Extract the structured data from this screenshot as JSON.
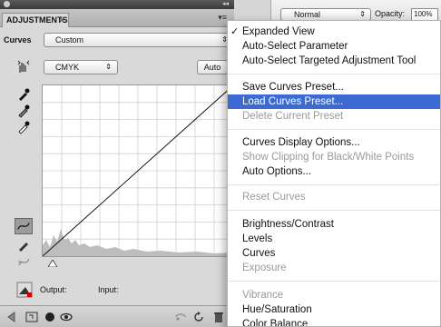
{
  "layers_bar": {
    "blend_mode": "Normal",
    "opacity_label": "Opacity:",
    "opacity_value": "100%"
  },
  "panel": {
    "tab_label": "ADJUSTMENTS",
    "tab_close": "×",
    "collapse_glyph": "◂◂",
    "menu_glyph": "▾≡",
    "adjustment_label": "Curves",
    "preset_value": "Custom",
    "channel_value": "CMYK",
    "auto_label": "Auto",
    "output_label": "Output:",
    "input_label": "Input:"
  },
  "menu": {
    "items": [
      {
        "label": "Expanded View",
        "checked": true,
        "disabled": false
      },
      {
        "label": "Auto-Select Parameter",
        "checked": false,
        "disabled": false
      },
      {
        "label": "Auto-Select Targeted Adjustment Tool",
        "checked": false,
        "disabled": false
      },
      {
        "label": "Save Curves Preset...",
        "checked": false,
        "disabled": false
      },
      {
        "label": "Load Curves Preset...",
        "checked": false,
        "disabled": false,
        "highlighted": true
      },
      {
        "label": "Delete Current Preset",
        "checked": false,
        "disabled": true
      },
      {
        "label": "Curves Display Options...",
        "checked": false,
        "disabled": false
      },
      {
        "label": "Show Clipping for Black/White Points",
        "checked": false,
        "disabled": true
      },
      {
        "label": "Auto Options...",
        "checked": false,
        "disabled": false
      },
      {
        "label": "Reset Curves",
        "checked": false,
        "disabled": true
      },
      {
        "label": "Brightness/Contrast",
        "checked": false,
        "disabled": false
      },
      {
        "label": "Levels",
        "checked": false,
        "disabled": false
      },
      {
        "label": "Curves",
        "checked": false,
        "disabled": false
      },
      {
        "label": "Exposure",
        "checked": false,
        "disabled": true
      },
      {
        "label": "Vibrance",
        "checked": false,
        "disabled": true
      },
      {
        "label": "Hue/Saturation",
        "checked": false,
        "disabled": false
      },
      {
        "label": "Color Balance",
        "checked": false,
        "disabled": false
      }
    ],
    "check_glyph": "✓",
    "highlight_color": "#3b6bd2"
  }
}
